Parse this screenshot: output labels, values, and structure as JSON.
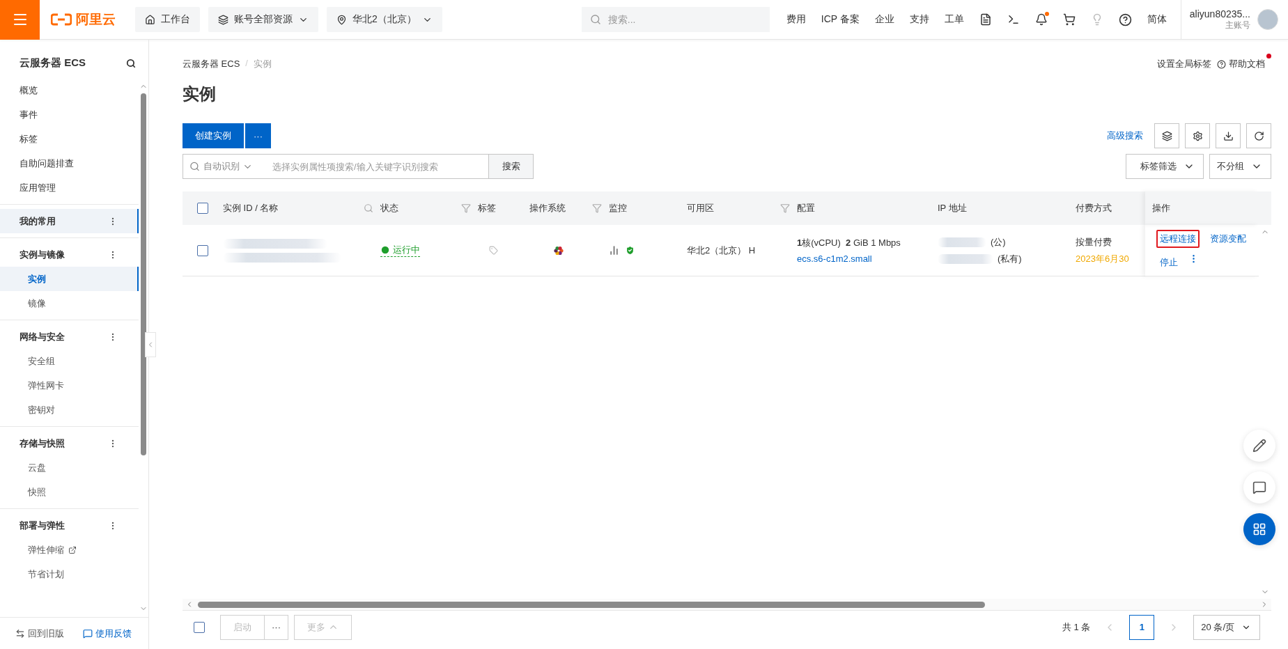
{
  "topbar": {
    "logo": "阿里云",
    "nav": [
      {
        "label": "工作台",
        "dropdown": false
      },
      {
        "label": "账号全部资源",
        "dropdown": true
      },
      {
        "label": "华北2（北京）",
        "dropdown": true
      }
    ],
    "search": {
      "placeholder": "搜索..."
    },
    "links": [
      "费用",
      "ICP 备案",
      "企业",
      "支持",
      "工单"
    ],
    "lang": "简体",
    "user": {
      "name": "aliyun80235...",
      "role": "主账号"
    }
  },
  "sidebar": {
    "title": "云服务器 ECS",
    "items": [
      {
        "label": "概览",
        "selected": false
      },
      {
        "label": "事件",
        "selected": false
      },
      {
        "label": "标签",
        "selected": false
      },
      {
        "label": "自助问题排查",
        "selected": false
      },
      {
        "label": "应用管理",
        "selected": false
      }
    ],
    "sections": [
      {
        "title": "我的常用",
        "selected": true
      },
      {
        "title": "实例与镜像",
        "selected": false,
        "items": [
          {
            "label": "实例",
            "selected": true,
            "external": false
          },
          {
            "label": "镜像",
            "selected": false,
            "external": false
          }
        ]
      },
      {
        "title": "网络与安全",
        "selected": false,
        "items": [
          {
            "label": "安全组",
            "selected": false,
            "external": false
          },
          {
            "label": "弹性网卡",
            "selected": false,
            "external": false
          },
          {
            "label": "密钥对",
            "selected": false,
            "external": false
          }
        ]
      },
      {
        "title": "存储与快照",
        "selected": false,
        "items": [
          {
            "label": "云盘",
            "selected": false,
            "external": false
          },
          {
            "label": "快照",
            "selected": false,
            "external": false
          }
        ]
      },
      {
        "title": "部署与弹性",
        "selected": false,
        "items": [
          {
            "label": "弹性伸缩",
            "selected": false,
            "external": true
          },
          {
            "label": "节省计划",
            "selected": false,
            "external": false
          }
        ]
      }
    ],
    "footer": {
      "back": "回到旧版",
      "feedback": "使用反馈"
    }
  },
  "breadcrumb": [
    "云服务器 ECS",
    "/",
    "实例"
  ],
  "header_links": {
    "tags": "设置全局标签",
    "help": "帮助文档"
  },
  "title": "实例",
  "toolbar": {
    "create": "创建实例",
    "more": "···",
    "advanced": "高级搜索"
  },
  "search": {
    "mode": "自动识别",
    "placeholder": "选择实例属性项搜索/输入关键字识别搜索",
    "button": "搜索",
    "tag_filter": "标签筛选",
    "group": "不分组"
  },
  "table": {
    "select_all": {
      "checked": false
    },
    "columns": [
      {
        "label": "实例 ID / 名称",
        "kind": "search"
      },
      {
        "label": "状态",
        "kind": "filter"
      },
      {
        "label": "标签",
        "kind": "plain"
      },
      {
        "label": "操作系统",
        "kind": "filter"
      },
      {
        "label": "监控",
        "kind": "plain"
      },
      {
        "label": "可用区",
        "kind": "filter"
      },
      {
        "label": "配置",
        "kind": "plain"
      },
      {
        "label": "IP 地址",
        "kind": "plain"
      },
      {
        "label": "付费方式",
        "kind": "plain"
      },
      {
        "label": "操作",
        "kind": "plain"
      }
    ],
    "rows": [
      {
        "checked": false,
        "status": "运行中",
        "zone": "华北2（北京） H",
        "config": "**1**核(vCPU)  **2** GiB 1 Mbps",
        "spec": "ecs.s6-c1m2.small",
        "ip_public": "(公)",
        "ip_private": "(私有)",
        "billing": "按量付费",
        "expiry": "2023年6月30",
        "actions": [
          {
            "label": "远程连接",
            "highlighted": true
          },
          {
            "label": "资源变配",
            "highlighted": false
          },
          {
            "label": "停止",
            "highlighted": false
          }
        ]
      }
    ]
  },
  "footer": {
    "checked": false,
    "start": "启动",
    "more_dots": "···",
    "more": "更多",
    "total": "共 1 条",
    "page": "1",
    "page_size": "20 条/页"
  }
}
